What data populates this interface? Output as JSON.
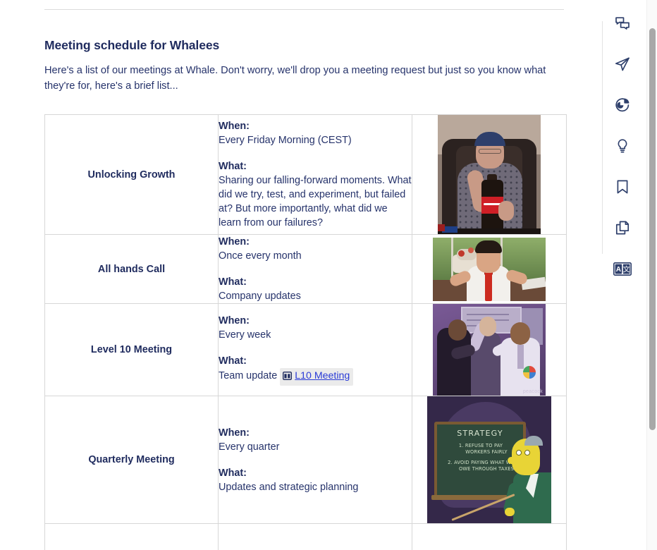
{
  "page": {
    "title": "Meeting schedule for Whalees",
    "description": "Here's a list of our meetings at Whale. Don't worry, we'll drop you a meeting request but just so you know what they're for, here's a brief list..."
  },
  "table": {
    "label_when": "When:",
    "label_what": "What:",
    "rows": [
      {
        "name": "Unlocking Growth",
        "when": "Every Friday Morning (CEST)",
        "what": "Sharing our falling-forward moments. What did we try, test, and experiment, but failed at? But more importantly, what did we learn from our failures?",
        "image_name": "gif-woman-with-cola-bottle"
      },
      {
        "name": "All hands Call",
        "when": "Once every month",
        "what": "Company updates",
        "image_name": "gif-man-red-tie-gesturing"
      },
      {
        "name": "Level 10 Meeting",
        "when": "Every week",
        "what": "Team update",
        "mention": {
          "icon": "table-columns-icon",
          "label": "L10 Meeting"
        },
        "image_name": "gif-office-celebration-peacock"
      },
      {
        "name": "Quarterly Meeting",
        "when": "Every quarter",
        "what": "Updates and strategic planning",
        "image_name": "gif-mr-burns-strategy-chalkboard",
        "image_text": {
          "heading": "STRATEGY",
          "line1": "1. REFUSE TO PAY",
          "line1b": "WORKERS FAIRLY",
          "line2": "2. AVOID PAYING WHAT WE",
          "line2b": "OWE THROUGH TAXES"
        }
      }
    ]
  },
  "illustration3": {
    "watermark": "peacock"
  },
  "rail": {
    "items": [
      {
        "icon": "comments-icon",
        "name": "comments"
      },
      {
        "icon": "send-icon",
        "name": "send"
      },
      {
        "icon": "pie-chart-icon",
        "name": "analytics"
      },
      {
        "icon": "lightbulb-icon",
        "name": "insights"
      },
      {
        "icon": "bookmark-icon",
        "name": "bookmark"
      },
      {
        "icon": "copy-icon",
        "name": "duplicate"
      },
      {
        "icon": "translate-icon",
        "name": "translate"
      }
    ]
  },
  "colors": {
    "heading": "#1f2b5e",
    "body": "#26336b",
    "link": "#2a3bd6",
    "border": "#d7d7d7",
    "chip_bg": "#ebebeb"
  }
}
